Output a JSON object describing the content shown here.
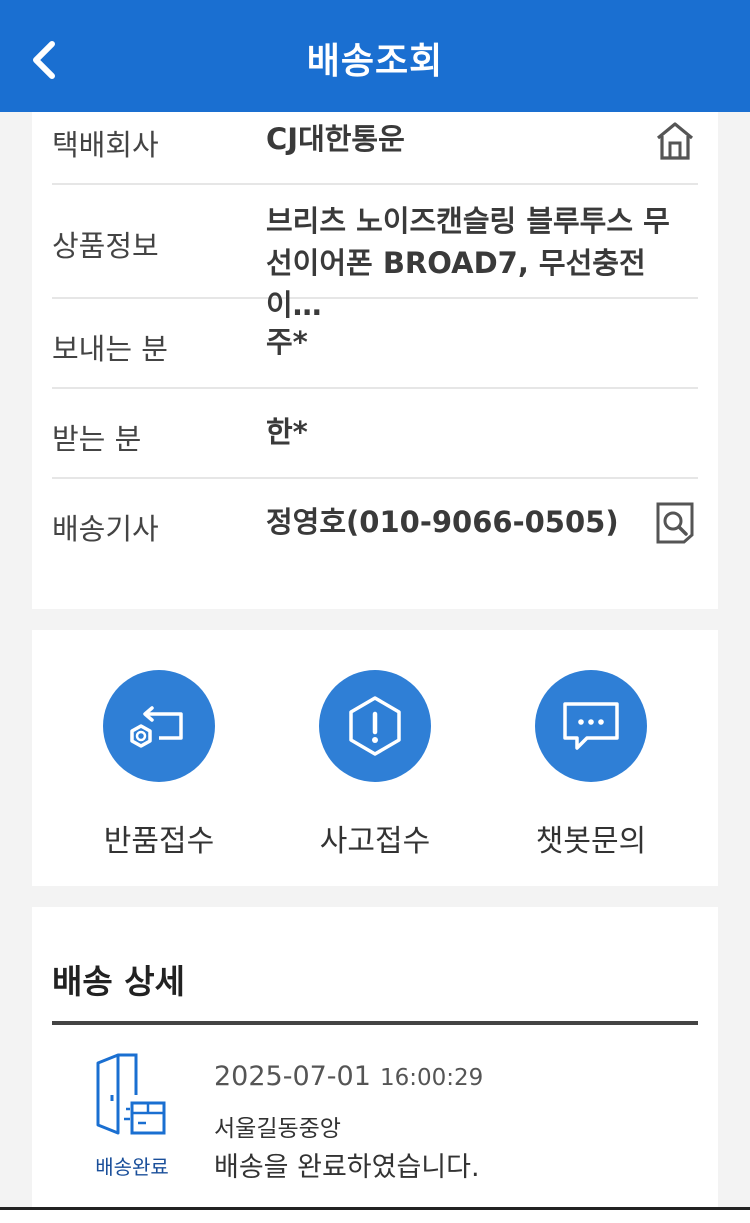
{
  "header": {
    "title": "배송조회"
  },
  "info": {
    "courier_label": "택배회사",
    "courier_value": "CJ대한통운",
    "product_label": "상품정보",
    "product_value_line1": "브리츠 노이즈캔슬링 블루투스 무",
    "product_value_line2": "선이어폰 BROAD7, 무선충전 이…",
    "sender_label": "보내는 분",
    "sender_value": "주*",
    "receiver_label": "받는 분",
    "receiver_value": "한*",
    "driver_label": "배송기사",
    "driver_value": "정영호(010-9066-0505)"
  },
  "actions": [
    {
      "label": "반품접수",
      "icon": "return-icon"
    },
    {
      "label": "사고접수",
      "icon": "accident-icon"
    },
    {
      "label": "챗봇문의",
      "icon": "chatbot-icon"
    }
  ],
  "detail": {
    "title": "배송 상세",
    "status_label": "배송완료",
    "date": "2025-07-01",
    "time": "16:00:29",
    "location": "서울길동중앙",
    "message": "배송을 완료하였습니다."
  },
  "colors": {
    "header": "#1a6fd1",
    "action_circle": "#2f7fd6",
    "status_text": "#1a4f9a"
  }
}
